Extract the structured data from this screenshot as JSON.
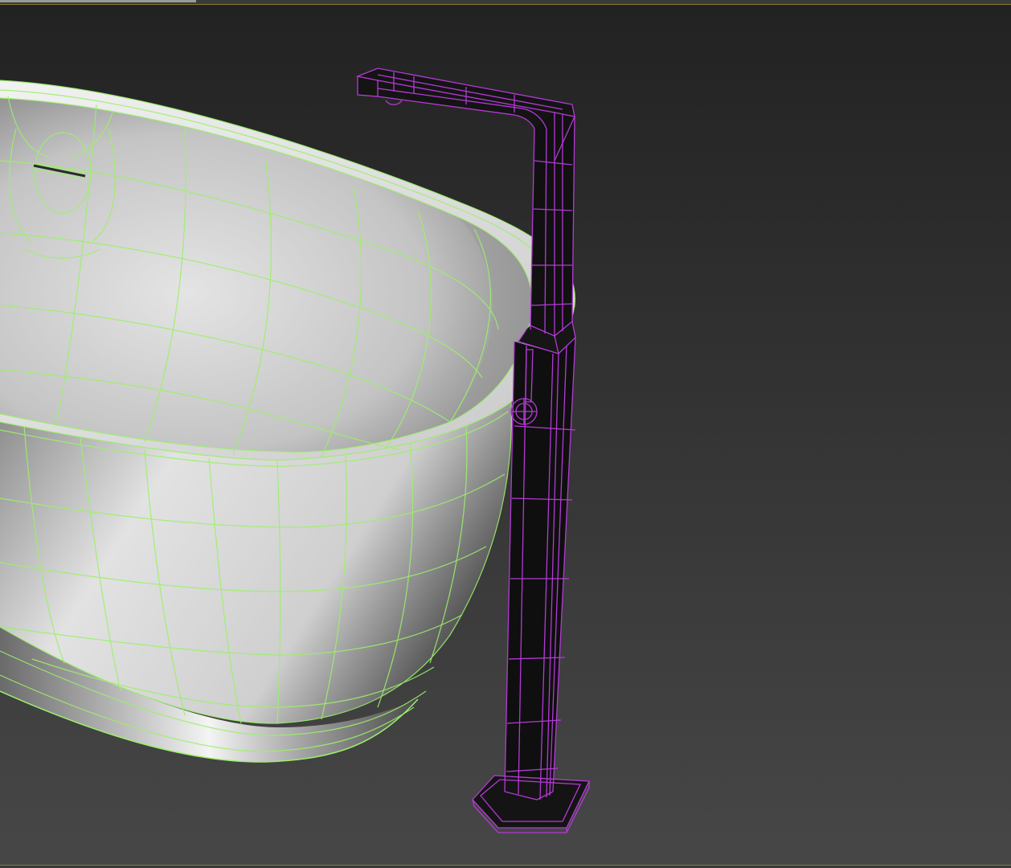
{
  "viewport": {
    "background_top": "#232323",
    "background_bottom": "#474747",
    "bathtub": {
      "wire_color": "#9cf06a",
      "shade_light": "#e8e8e8",
      "shade_dark": "#5a5a5a"
    },
    "faucet": {
      "wire_color": "#b43ad6",
      "body_color": "#111111"
    },
    "frame_accent": "#8a7a3a"
  }
}
